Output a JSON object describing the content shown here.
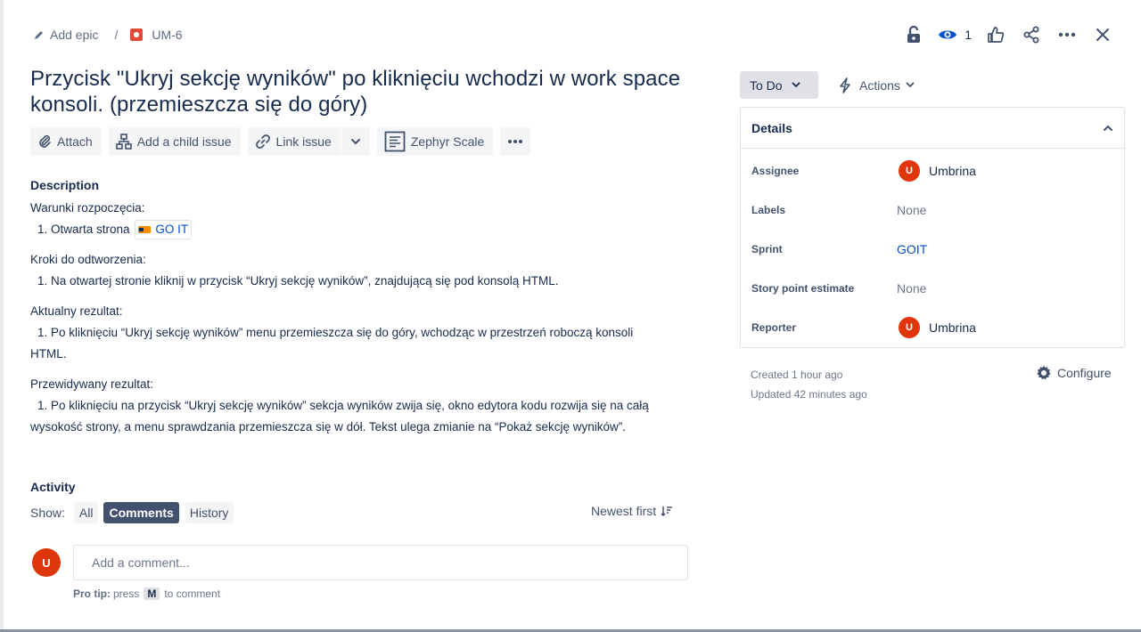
{
  "breadcrumb": {
    "epic_label": "Add epic",
    "separator": "/",
    "issue_key": "UM-6"
  },
  "header": {
    "watch_count": "1"
  },
  "issue": {
    "title": "Przycisk \"Ukryj sekcję wyników\" po kliknięciu wchodzi w work space konsoli. (przemieszcza się do góry)"
  },
  "toolbar": {
    "attach": "Attach",
    "add_child": "Add a child issue",
    "link_issue": "Link issue",
    "zephyr": "Zephyr Scale"
  },
  "description": {
    "heading": "Description",
    "sections": [
      {
        "heading": "Warunki rozpoczęcia:",
        "item_prefix": "1. Otwarta strona",
        "link_text": "GO IT"
      },
      {
        "heading": "Kroki do odtworzenia:",
        "item": "1. Na otwartej stronie kliknij w przycisk “Ukryj sekcję wyników”, znajdującą się pod konsolą HTML."
      },
      {
        "heading": "Aktualny rezultat:",
        "item_line1": "1. Po kliknięciu “Ukryj sekcję wyników” menu przemieszcza się do góry, wchodząc w przestrzeń roboczą konsoli",
        "item_line2": "HTML."
      },
      {
        "heading": "Przewidywany rezultat:",
        "item_line1": "1. Po kliknięciu na przycisk “Ukryj sekcję wyników” sekcja wyników zwija się, okno edytora kodu rozwija się na całą",
        "item_line2": "wysokość strony, a menu sprawdzania przemieszcza się w dół. Tekst ulega zmianie na “Pokaż sekcję wyników”."
      }
    ]
  },
  "activity": {
    "heading": "Activity",
    "show_label": "Show:",
    "filters": [
      "All",
      "Comments",
      "History"
    ],
    "active_filter": "Comments",
    "sort_label": "Newest first",
    "comment_avatar": "U",
    "comment_placeholder": "Add a comment...",
    "protip_label": "Pro tip:",
    "protip_press": "press",
    "protip_key": "M",
    "protip_suffix": "to comment"
  },
  "status": {
    "label": "To Do"
  },
  "actions": {
    "label": "Actions"
  },
  "details": {
    "heading": "Details",
    "assignee_label": "Assignee",
    "assignee_initial": "U",
    "assignee": "Umbrina",
    "labels_label": "Labels",
    "labels_value": "None",
    "sprint_label": "Sprint",
    "sprint_value": "GOIT",
    "story_label": "Story point estimate",
    "story_value": "None",
    "reporter_label": "Reporter",
    "reporter_initial": "U",
    "reporter": "Umbrina"
  },
  "meta": {
    "created": "Created 1 hour ago",
    "updated": "Updated 42 minutes ago",
    "configure": "Configure"
  },
  "colors": {
    "accent": "#0052cc",
    "avatar": "#de350b",
    "text": "#172b4d",
    "muted": "#6b778c",
    "active_pill": "#42526e"
  },
  "icons": [
    "pencil-icon",
    "bug-icon",
    "unlock-icon",
    "eye-icon",
    "thumbs-up-icon",
    "share-icon",
    "more-icon",
    "close-icon",
    "paperclip-icon",
    "child-issue-icon",
    "link-icon",
    "chevron-down-icon",
    "zephyr-icon",
    "bolt-icon",
    "chevron-up-icon",
    "sort-icon",
    "gear-icon"
  ]
}
